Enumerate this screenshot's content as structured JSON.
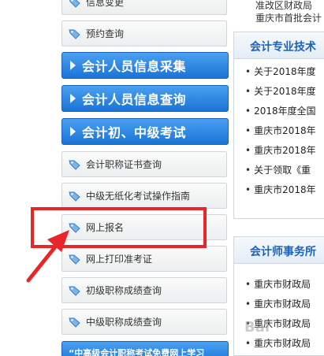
{
  "sidebar": {
    "top_item": "信息变更",
    "item_query": "预约查询",
    "main1": "会计人员信息采集",
    "main2": "会计人员信息查询",
    "main3": "会计初、中级考试",
    "sub1": "会计职称证书查询",
    "sub2": "中级无纸化考试操作指南",
    "sub3": "网上报名",
    "sub4": "网上打印准考证",
    "sub5": "初级职称成绩查询",
    "sub6": "中级职称成绩查询",
    "bottom": "“中高级会计职称考试免费网上学习"
  },
  "right": {
    "top_line1": "准改区财政局",
    "top_line2": "重庆市首批会计",
    "panel1_title": "会计专业技术",
    "panel1_items": [
      "关于2018年度",
      "关于2018年度",
      "2018年度全国",
      "重庆市2018年",
      "重庆市2018年",
      "关于领取《重",
      "重庆市2018年"
    ],
    "panel2_title": "会计师事务所",
    "panel2_items": [
      "重庆市财政局",
      "重庆市财政局",
      "重庆市财政局",
      "重庆市财政局"
    ]
  },
  "watermark": "Bai"
}
